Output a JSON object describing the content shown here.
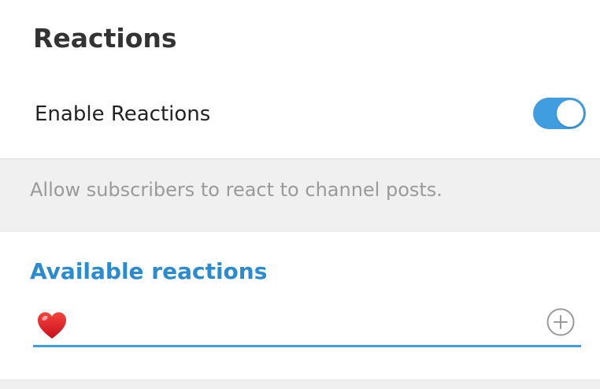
{
  "header": {
    "title": "Reactions"
  },
  "settings": {
    "enable_reactions": {
      "label": "Enable Reactions",
      "enabled": true
    },
    "hint": "Allow subscribers to react to channel posts."
  },
  "available_reactions": {
    "title": "Available reactions",
    "reactions": [
      {
        "icon": "red-heart-icon"
      }
    ],
    "add_icon": "add-circle-icon"
  },
  "colors": {
    "accent": "#3f9de0",
    "section_title": "#2a8bd0",
    "hint_text": "#9a9a9a",
    "background": "#f0f0f0"
  }
}
